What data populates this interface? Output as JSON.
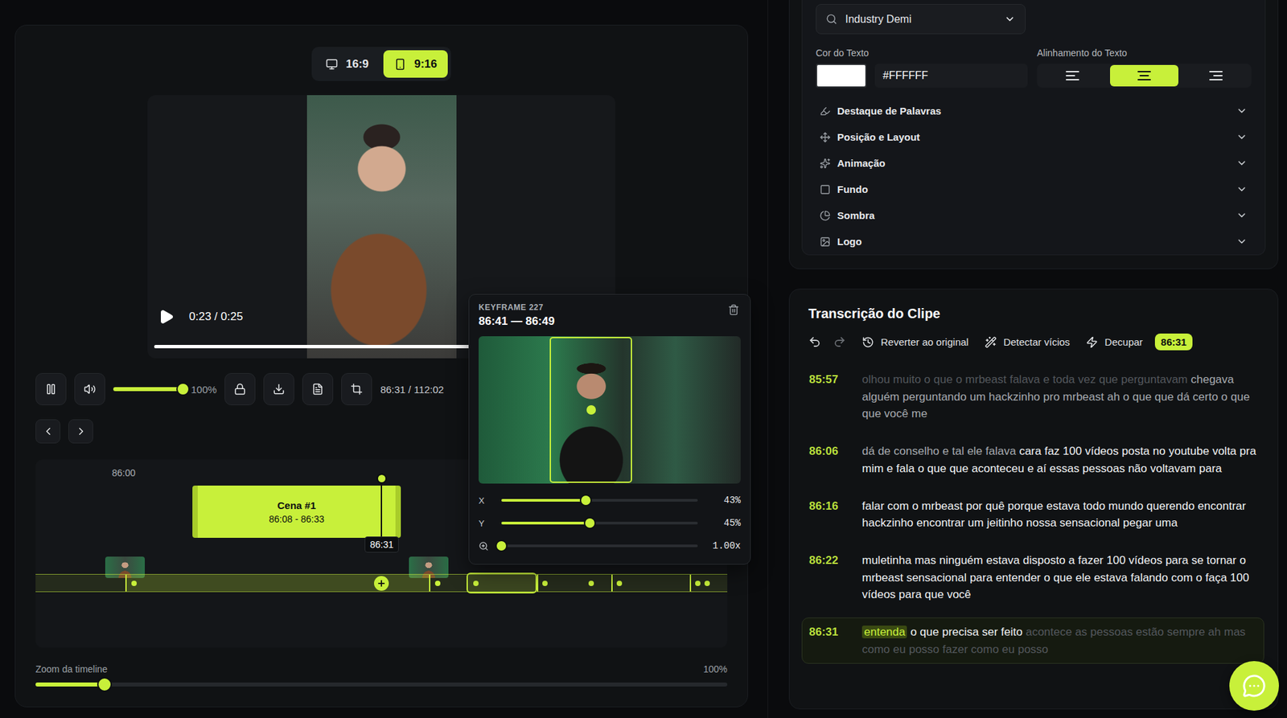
{
  "editor": {
    "aspect_options": [
      {
        "label": "16:9",
        "kind": "desktop",
        "selected": false
      },
      {
        "label": "9:16",
        "kind": "mobile",
        "selected": true
      }
    ],
    "player": {
      "time": "0:23 / 0:25",
      "level": 0.92
    },
    "controls": {
      "volume": {
        "level": 1,
        "reading": "100%"
      },
      "timecode": "86:31 / 112:02"
    },
    "timeline": {
      "ruler_label": "86:00",
      "scene": {
        "title": "Cena #1",
        "range": "86:08 - 86:33"
      },
      "playhead": "86:31",
      "keyframes": [
        {
          "selected": false
        },
        {
          "selected": false
        },
        {
          "selected": true
        },
        {
          "selected": false
        },
        {
          "selected": false
        },
        {
          "selected": false
        },
        {
          "selected": false
        },
        {
          "selected": false
        }
      ]
    },
    "timeline_zoom": {
      "label": "Zoom da timeline",
      "level": 0.1,
      "reading": "100%"
    },
    "keyframe_popover": {
      "title": "KEYFRAME 227",
      "range": "86:41 — 86:49",
      "sliders": [
        {
          "kind": "axis",
          "label": "X",
          "level": 0.43,
          "reading": "43%"
        },
        {
          "kind": "axis",
          "label": "Y",
          "level": 0.45,
          "reading": "45%"
        },
        {
          "kind": "zoom",
          "label": "",
          "level": 0,
          "reading": "1.00x"
        }
      ]
    }
  },
  "style_panel": {
    "font": "Industry Demi",
    "text_color": {
      "label": "Cor do Texto",
      "value": "#FFFFFF"
    },
    "alignment": {
      "label": "Alinhamento do Texto",
      "options": [
        {
          "kind": "left",
          "selected": false
        },
        {
          "kind": "center",
          "selected": true
        },
        {
          "kind": "right",
          "selected": false
        }
      ]
    },
    "sections": [
      {
        "kind": "highlight",
        "label": "Destaque de Palavras",
        "expanded": false
      },
      {
        "kind": "layout",
        "label": "Posição e Layout",
        "expanded": false
      },
      {
        "kind": "animation",
        "label": "Animação",
        "expanded": false
      },
      {
        "kind": "background",
        "label": "Fundo",
        "expanded": false
      },
      {
        "kind": "shadow",
        "label": "Sombra",
        "expanded": false
      },
      {
        "kind": "logo",
        "label": "Logo",
        "expanded": false
      }
    ]
  },
  "transcript": {
    "title": "Transcrição do Clipe",
    "history": [
      {
        "kind": "undo",
        "disabled": false
      },
      {
        "kind": "redo",
        "disabled": true
      }
    ],
    "actions": [
      {
        "kind": "revert",
        "label": "Reverter ao original"
      },
      {
        "kind": "detect",
        "label": "Detectar vícios"
      },
      {
        "kind": "cut",
        "label": "Decupar"
      }
    ],
    "badge": "86:31",
    "segments": [
      {
        "time": "85:57",
        "active": false,
        "spans": [
          {
            "text": "olhou muito o que o mrbeast falava e toda vez que perguntavam ",
            "tone": "faint"
          },
          {
            "text": "chegava alguém perguntando um hackzinho pro mrbeast ah o que que dá certo o que que você me",
            "tone": "muted"
          }
        ]
      },
      {
        "time": "86:06",
        "active": false,
        "spans": [
          {
            "text": "dá de conselho e tal ele falava ",
            "tone": "muted"
          },
          {
            "text": "cara faz 100 vídeos posta no youtube volta pra mim e fala o que que aconteceu e aí essas pessoas não voltavam para",
            "tone": "normal"
          }
        ]
      },
      {
        "time": "86:16",
        "active": false,
        "spans": [
          {
            "text": "falar com o mrbeast por quê porque estava todo mundo querendo encontrar hackzinho encontrar um jeitinho nossa sensacional pegar uma",
            "tone": "normal"
          }
        ]
      },
      {
        "time": "86:22",
        "active": false,
        "spans": [
          {
            "text": "muletinha mas ninguém estava disposto a fazer 100 vídeos para se tornar o mrbeast sensacional para entender o que ele estava falando com o faça 100 vídeos para que você",
            "tone": "normal"
          }
        ]
      },
      {
        "time": "86:31",
        "active": true,
        "spans": [
          {
            "text": "entenda",
            "tone": "highlight"
          },
          {
            "text": " o que precisa ser feito ",
            "tone": "normal"
          },
          {
            "text": "acontece as pessoas estão sempre ",
            "tone": "faint"
          },
          {
            "text": "ah mas como eu posso fazer como eu posso",
            "tone": "faint"
          }
        ]
      }
    ]
  }
}
